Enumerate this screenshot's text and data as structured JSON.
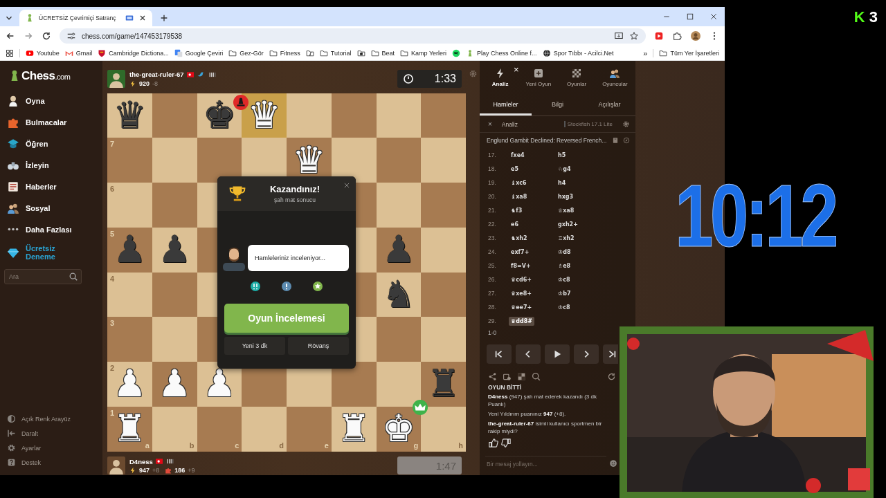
{
  "browser": {
    "tab": {
      "title": "ÜCRETSİZ Çevrimiçi Satranç",
      "selected": true
    },
    "address": "chess.com/game/147453179538",
    "bookmarks": [
      {
        "label": "Youtube",
        "kind": "youtube"
      },
      {
        "label": "Gmail",
        "kind": "gmail"
      },
      {
        "label": "Cambridge Dictiona...",
        "kind": "shield"
      },
      {
        "label": "Google Çeviri",
        "kind": "translate"
      },
      {
        "label": "Gez-Gör",
        "kind": "folder"
      },
      {
        "label": "Fitness",
        "kind": "folder"
      },
      {
        "kind": "music"
      },
      {
        "label": "Tutorial",
        "kind": "folder"
      },
      {
        "kind": "film"
      },
      {
        "label": "Beat",
        "kind": "folder"
      },
      {
        "label": "Kamp Yerleri",
        "kind": "folder"
      },
      {
        "kind": "spotify"
      },
      {
        "label": "Play Chess Online f...",
        "kind": "pawn"
      },
      {
        "label": "Spor Tıbbı - Acilci.Net",
        "kind": "globe"
      }
    ],
    "more": "»",
    "all_bookmarks": "Tüm Yer İşaretleri"
  },
  "sidebar": {
    "logo": {
      "name": "Chess",
      "suffix": ".com"
    },
    "items": [
      {
        "label": "Oyna",
        "kind": "play"
      },
      {
        "label": "Bulmacalar",
        "kind": "puzzle"
      },
      {
        "label": "Öğren",
        "kind": "cap"
      },
      {
        "label": "İzleyin",
        "kind": "binoculars"
      },
      {
        "label": "Haberler",
        "kind": "news"
      },
      {
        "label": "Sosyal",
        "kind": "people"
      },
      {
        "label": "Daha Fazlası",
        "kind": "dots"
      },
      {
        "label": "Ücretsiz Deneme",
        "kind": "diamond"
      }
    ],
    "search": {
      "placeholder": "Ara"
    },
    "footer": [
      {
        "label": "Açık Renk Arayüz",
        "kind": "contrast"
      },
      {
        "label": "Daralt",
        "kind": "collapse"
      },
      {
        "label": "Ayarlar",
        "kind": "gear"
      },
      {
        "label": "Destek",
        "kind": "help"
      }
    ]
  },
  "top_player": {
    "name": "the-great-ruler-67",
    "rating": "920",
    "change": "-8",
    "clock": "1:33",
    "active": true
  },
  "bottom_player": {
    "name": "D4ness",
    "rating": "947",
    "change": "+8",
    "puzzle_rating": "186",
    "puzzle_change": "+9",
    "clock": "1:47",
    "active": false
  },
  "board": {
    "rows": [
      {
        "cells": [
          {
            "piece": "♛",
            "kind": "black",
            "highlighted": false
          },
          {
            "highlighted": false
          },
          {
            "piece": "♚",
            "kind": "black",
            "highlighted": false,
            "badge": {
              "kind": "checkmate"
            }
          },
          {
            "piece": "♛",
            "kind": "white",
            "highlighted": true
          },
          {
            "highlighted": false
          },
          {
            "highlighted": false
          },
          {
            "highlighted": false
          },
          {
            "highlighted": false
          }
        ]
      },
      {
        "cells": [
          {
            "rank_label": "7",
            "highlighted": false
          },
          {
            "highlighted": false
          },
          {
            "highlighted": false
          },
          {
            "highlighted": false
          },
          {
            "piece": "♛",
            "kind": "white",
            "highlighted": false
          },
          {
            "highlighted": false
          },
          {
            "highlighted": false
          },
          {
            "highlighted": false
          }
        ]
      },
      {
        "cells": [
          {
            "rank_label": "6",
            "highlighted": false
          },
          {
            "highlighted": false
          },
          {
            "highlighted": false
          },
          {},
          {},
          {
            "highlighted": false
          },
          {
            "highlighted": false
          },
          {
            "highlighted": false
          }
        ]
      },
      {
        "cells": [
          {
            "rank_label": "5",
            "piece": "♟",
            "kind": "black",
            "highlighted": false
          },
          {
            "piece": "♟",
            "kind": "black",
            "highlighted": false
          },
          {
            "highlighted": false
          },
          {},
          {},
          {
            "highlighted": false
          },
          {
            "piece": "♟",
            "kind": "black",
            "highlighted": false
          },
          {
            "highlighted": false
          }
        ]
      },
      {
        "cells": [
          {
            "rank_label": "4",
            "highlighted": false
          },
          {
            "highlighted": false
          },
          {
            "highlighted": false
          },
          {},
          {},
          {
            "highlighted": false
          },
          {
            "piece": "♞",
            "kind": "black",
            "highlighted": false
          },
          {
            "highlighted": false
          }
        ]
      },
      {
        "cells": [
          {
            "rank_label": "3",
            "highlighted": false
          },
          {
            "highlighted": false
          },
          {
            "highlighted": false
          },
          {},
          {},
          {
            "highlighted": false
          },
          {
            "highlighted": false
          },
          {
            "highlighted": false
          }
        ]
      },
      {
        "cells": [
          {
            "rank_label": "2",
            "piece": "♟",
            "kind": "white",
            "highlighted": false
          },
          {
            "piece": "♟",
            "kind": "white",
            "highlighted": false
          },
          {
            "piece": "♟",
            "kind": "white",
            "highlighted": false
          },
          {
            "highlighted": false
          },
          {
            "highlighted": false
          },
          {
            "highlighted": false
          },
          {
            "highlighted": false
          },
          {
            "piece": "♜",
            "kind": "black",
            "highlighted": false
          }
        ]
      },
      {
        "cells": [
          {
            "rank_label": "1",
            "file_label": "a",
            "piece": "♜",
            "kind": "white",
            "highlighted": false
          },
          {
            "file_label": "b",
            "highlighted": false
          },
          {
            "file_label": "c",
            "highlighted": false
          },
          {
            "file_label": "d",
            "highlighted": false
          },
          {
            "file_label": "e",
            "highlighted": false
          },
          {
            "piece": "♜",
            "kind": "white",
            "highlighted": false
          },
          {
            "file_label": "g",
            "piece": "♚",
            "kind": "white",
            "highlighted": false,
            "badge": {
              "kind": "winner"
            }
          },
          {
            "file_label": "h",
            "highlighted": false
          }
        ]
      }
    ]
  },
  "result_modal": {
    "title": "Kazandınız!",
    "subtitle": "şah mat sonucu",
    "bubble": "Hamleleriniz inceleniyor...",
    "primary_button": "Oyun İncelemesi",
    "buttons": [
      "Yeni 3 dk",
      "Rövanş"
    ]
  },
  "right_panel": {
    "nav": [
      {
        "label": "Analiz",
        "kind": "bolt",
        "selected": true,
        "close": "×"
      },
      {
        "label": "Yeni Oyun",
        "kind": "plus",
        "selected": false
      },
      {
        "label": "Oyunlar",
        "kind": "board",
        "selected": false
      },
      {
        "label": "Oyuncular",
        "kind": "people",
        "selected": false
      }
    ],
    "tabs": [
      {
        "label": "Hamleler",
        "selected": true
      },
      {
        "label": "Bilgi",
        "selected": false
      },
      {
        "label": "Açılışlar",
        "selected": false
      }
    ],
    "analysis": {
      "close": "×",
      "label": "Analiz",
      "engine": "Stockfish 17.1 Lite"
    },
    "opening": "Englund Gambit Declined: Reversed French...",
    "moves": [
      {
        "number": "17.",
        "white": {
          "text": "fxe4",
          "selected": false
        },
        "black": {
          "text": "h5",
          "selected": false
        }
      },
      {
        "number": "18.",
        "white": {
          "text": "e5",
          "selected": false
        },
        "black": {
          "text": "♘g4",
          "selected": false
        }
      },
      {
        "number": "19.",
        "white": {
          "text": "♝xc6",
          "selected": false
        },
        "black": {
          "text": "h4",
          "selected": false
        }
      },
      {
        "number": "20.",
        "white": {
          "text": "♝xa8",
          "selected": false
        },
        "black": {
          "text": "hxg3",
          "selected": false
        }
      },
      {
        "number": "21.",
        "white": {
          "text": "♞f3",
          "selected": false
        },
        "black": {
          "text": "♕xa8",
          "selected": false
        }
      },
      {
        "number": "22.",
        "white": {
          "text": "e6",
          "selected": false
        },
        "black": {
          "text": "gxh2+",
          "selected": false
        }
      },
      {
        "number": "23.",
        "white": {
          "text": "♞xh2",
          "selected": false
        },
        "black": {
          "text": "♖xh2",
          "selected": false
        }
      },
      {
        "number": "24.",
        "white": {
          "text": "exf7+",
          "selected": false
        },
        "black": {
          "text": "♔d8",
          "selected": false
        }
      },
      {
        "number": "25.",
        "white": {
          "text": "f8=V+",
          "selected": false
        },
        "black": {
          "text": "♗e8",
          "selected": false
        }
      },
      {
        "number": "26.",
        "white": {
          "text": "♛cd6+",
          "selected": false
        },
        "black": {
          "text": "♔c8",
          "selected": false
        }
      },
      {
        "number": "27.",
        "white": {
          "text": "♛xe8+",
          "selected": false
        },
        "black": {
          "text": "♔b7",
          "selected": false
        }
      },
      {
        "number": "28.",
        "white": {
          "text": "♛ee7+",
          "selected": false
        },
        "black": {
          "text": "♔c8",
          "selected": false
        }
      },
      {
        "number": "29.",
        "white": {
          "text": "♛dd8#",
          "selected": true
        }
      }
    ],
    "result": "1-0",
    "controls": [
      {
        "kind": "first"
      },
      {
        "kind": "prev"
      },
      {
        "kind": "play"
      },
      {
        "kind": "next"
      },
      {
        "kind": "last"
      }
    ],
    "chat": [
      {
        "kind": "header",
        "text": "OYUN BİTTİ"
      },
      {
        "kind": "text",
        "text": "**D4ness** (947) şah mat ederek kazandı (3 dk Puanlı)"
      },
      {
        "kind": "text",
        "text": "Yeni Yıldırım puanınız **947** (+8)."
      },
      {
        "kind": "sportsmanship",
        "text": "**the-great-ruler-67** isimli kullanıcı sportmen bir rakip miydi?"
      }
    ],
    "chat_input": {
      "placeholder": "Bir mesaj yollayın..."
    }
  },
  "stream_overlay": {
    "badge_letter": "K",
    "badge_number": "3",
    "timer": "10:12"
  }
}
